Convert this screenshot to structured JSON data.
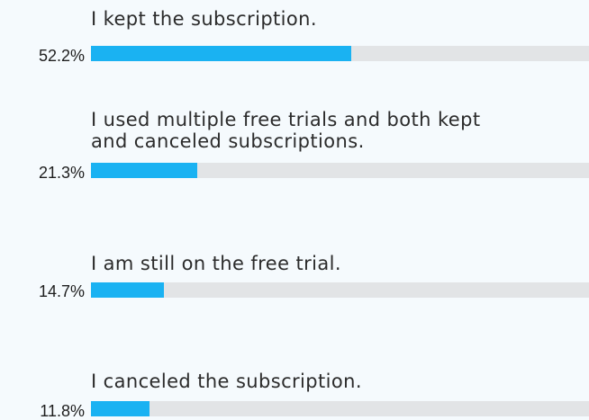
{
  "chart_data": {
    "type": "bar",
    "orientation": "horizontal",
    "categories": [
      "I kept the subscription.",
      "I used multiple free trials and both kept and canceled subscriptions.",
      "I am still on the free trial.",
      "I canceled the subscription."
    ],
    "values": [
      52.2,
      21.3,
      14.7,
      11.8
    ],
    "value_labels": [
      "52.2%",
      "21.3%",
      "14.7%",
      "11.8%"
    ],
    "xlim": [
      0,
      100
    ],
    "grid": false,
    "legend": "none"
  },
  "colors": {
    "bar": "#1ab2f2",
    "track": "#e2e4e6",
    "background": "#f5fafd",
    "text": "#2b2b2b"
  }
}
